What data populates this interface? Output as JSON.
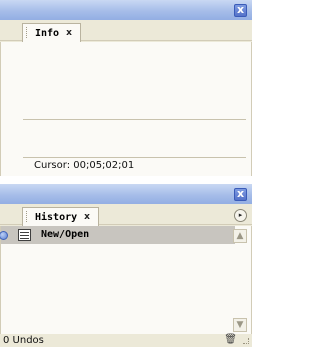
{
  "info_panel": {
    "tab_label": "Info",
    "tab_close": "x",
    "close_glyph": "x",
    "cursor_text": "Cursor:  00;05;02;01"
  },
  "history_panel": {
    "tab_label": "History",
    "tab_close": "x",
    "close_glyph": "x",
    "menu_glyph": "▸",
    "items": [
      {
        "label": "New/Open",
        "icon": "document-list-icon",
        "state": "current"
      }
    ],
    "status": "0 Undos",
    "scroll_up_glyph": "▲",
    "scroll_down_glyph": "▼",
    "trash_glyph": "🗑"
  },
  "colors": {
    "titlebar": "#a6bde9",
    "panel_bg": "#ece9d8",
    "content_bg": "#fbfaf6",
    "selected_row": "#c8c5bf"
  }
}
